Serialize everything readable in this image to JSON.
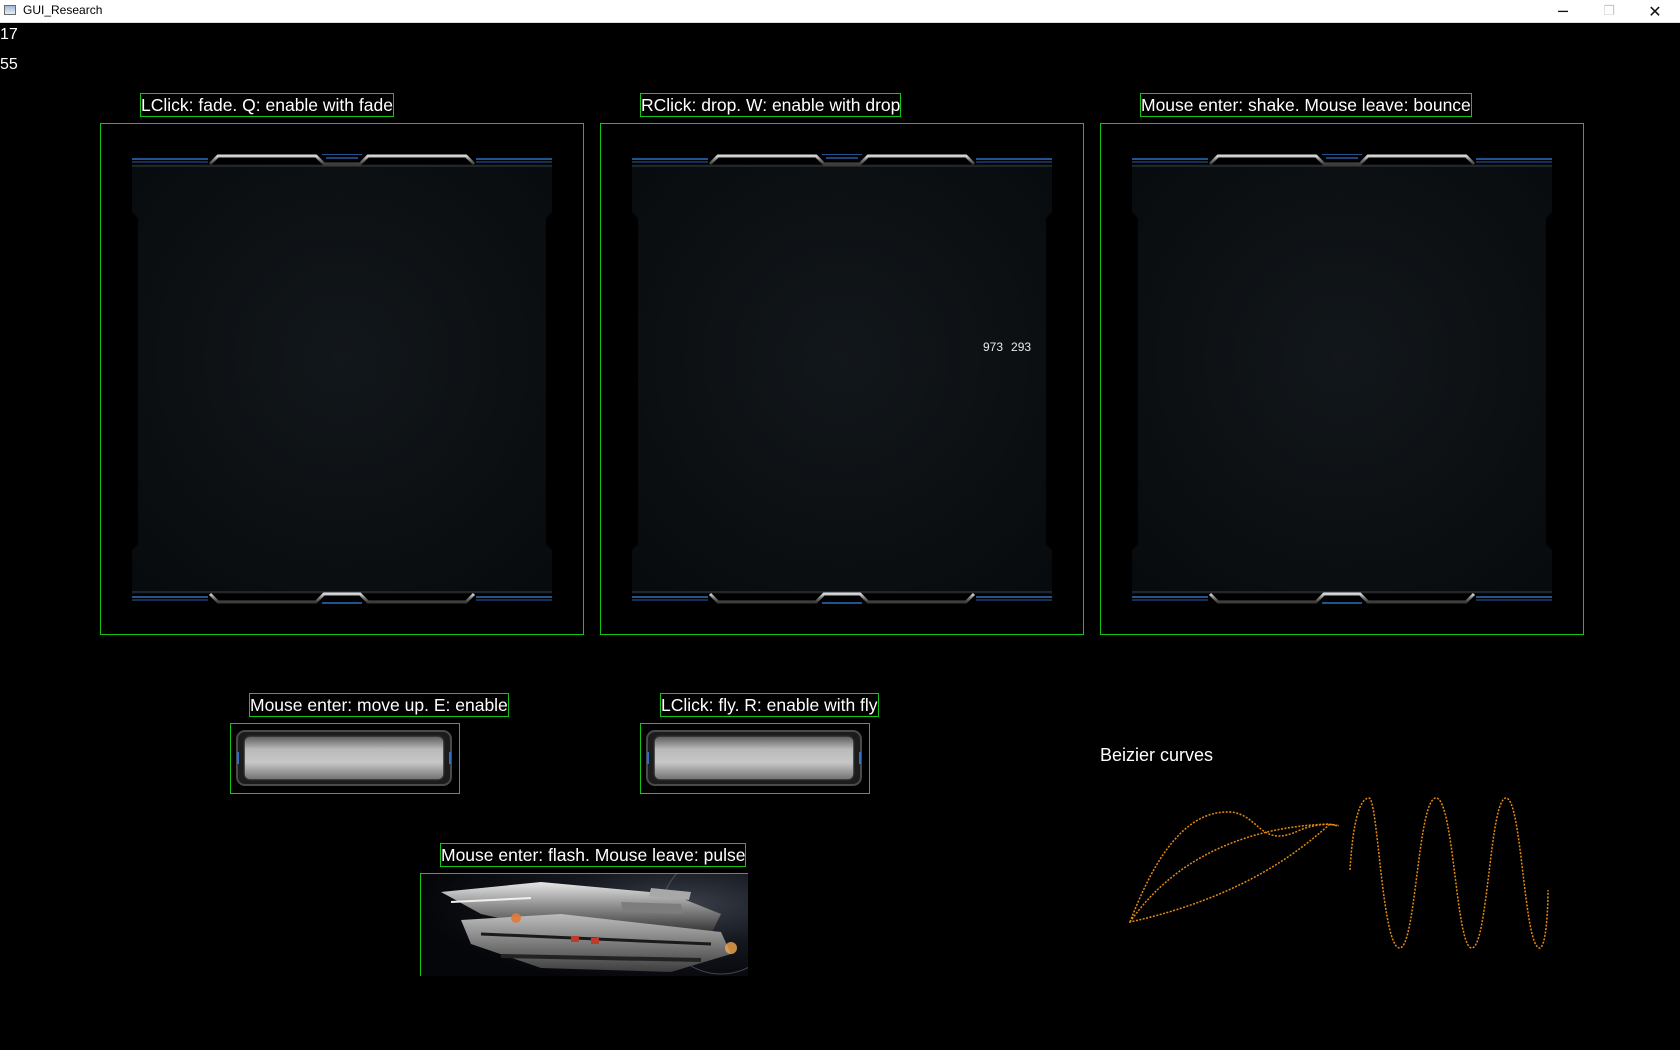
{
  "window": {
    "title": "GUI_Research",
    "controls": {
      "minimize": "─",
      "maximize": "❐",
      "close": "✕"
    }
  },
  "counters": [
    "17",
    "55"
  ],
  "panels": [
    {
      "caption": "LClick: fade. Q: enable with fade"
    },
    {
      "caption": "RClick: drop. W: enable with drop"
    },
    {
      "caption": "Mouse enter: shake. Mouse leave: bounce"
    }
  ],
  "cursor_readout": {
    "x": "973",
    "y": "293"
  },
  "buttons": [
    {
      "caption": "Mouse enter: move up. E: enable"
    },
    {
      "caption": "LClick: fly. R: enable with fly"
    }
  ],
  "image_widget": {
    "caption": "Mouse enter: flash. Mouse leave: pulse"
  },
  "curves": {
    "title": "Beizier curves",
    "color": "#e58a10"
  },
  "colors": {
    "outline": "#15c515",
    "panel_bg": "#0d1114",
    "accent_blue": "#2f6ec0"
  },
  "icons": {
    "app": "window-app-icon",
    "minimize": "minimize-icon",
    "maximize": "maximize-icon",
    "close": "close-icon"
  }
}
